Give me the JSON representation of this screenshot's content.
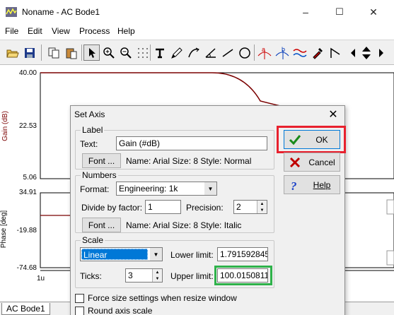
{
  "window": {
    "title": "Noname - AC Bode1",
    "controls": {
      "minimize": "–",
      "maximize": "☐",
      "close": "✕"
    }
  },
  "menu": [
    "File",
    "Edit",
    "View",
    "Process",
    "Help"
  ],
  "toolbar": {
    "buttons": [
      "open-icon",
      "save-icon",
      "copy-icon",
      "paste-icon",
      "pointer-icon",
      "zoom-in-icon",
      "zoom-100-icon",
      "grid-icon",
      "text-icon",
      "pen-icon",
      "curve-icon",
      "angle-icon",
      "line-icon",
      "circle-icon",
      "marker-a-icon",
      "marker-b-icon",
      "wave-icon",
      "dropper-icon",
      "flag-icon",
      "left-arrow-icon",
      "up-down-icon",
      "right-arrow-icon"
    ]
  },
  "plot": {
    "gain_axis_label": "Gain (dB)",
    "phase_axis_label": "Phase [deg]",
    "gain_ticks": [
      "40.00",
      "22.53",
      "5.06"
    ],
    "phase_ticks": [
      "34.91",
      "-19.88",
      "-74.68"
    ],
    "x_tick": "1u",
    "curve_color": "#7b0000"
  },
  "status_tab": "AC Bode1",
  "dialog": {
    "title": "Set Axis",
    "close": "✕",
    "label_group": {
      "legend": "Label",
      "text_label": "Text:",
      "text_value": "Gain (#dB)",
      "font_button": "Font ...",
      "font_info": "Name: Arial Size: 8 Style: Normal"
    },
    "numbers_group": {
      "legend": "Numbers",
      "format_label": "Format:",
      "format_value": "Engineering: 1k",
      "divide_label": "Divide by factor:",
      "divide_value": "1",
      "precision_label": "Precision:",
      "precision_value": "2",
      "font_button": "Font ...",
      "font_info": "Name: Arial Size: 8 Style: Italic"
    },
    "scale_group": {
      "legend": "Scale",
      "scale_value": "Linear",
      "lower_label": "Lower limit:",
      "lower_value": "1.791592845",
      "ticks_label": "Ticks:",
      "ticks_value": "3",
      "upper_label": "Upper limit:",
      "upper_value": "100.0150811"
    },
    "checkboxes": {
      "force_size": "Force size settings when resize window",
      "round_scale": "Round axis scale"
    },
    "buttons": {
      "ok": "OK",
      "cancel": "Cancel",
      "help": "Help"
    }
  },
  "colors": {
    "highlight_ok": "#e8212e",
    "highlight_upper": "#2eb24a",
    "selection": "#0078d7"
  }
}
